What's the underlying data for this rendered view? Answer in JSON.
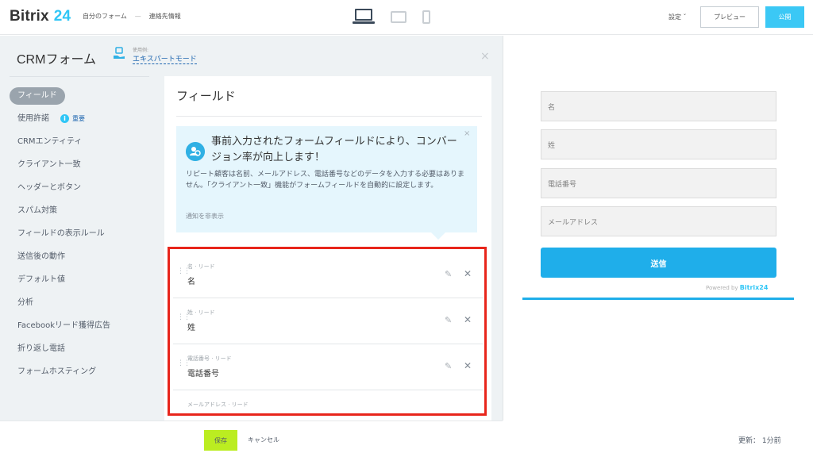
{
  "header": {
    "logo_text": "Bitrix",
    "logo_num": "24",
    "breadcrumb": [
      "自分のフォーム",
      "—",
      "連絡先情報"
    ],
    "devices": [
      "laptop-icon",
      "tablet-icon",
      "phone-icon"
    ],
    "settings_label": "設定 ˇ",
    "preview_label": "プレビュー",
    "publish_label": "公開"
  },
  "panel": {
    "title": "CRMフォーム",
    "mode_small": "使用例:",
    "mode_link": "エキスパートモード",
    "close": "×"
  },
  "sidebar": {
    "items": [
      {
        "label": "フィールド",
        "active": true
      },
      {
        "label": "使用許諾",
        "badge": "重要"
      },
      {
        "label": "CRMエンティティ"
      },
      {
        "label": "クライアント一致"
      },
      {
        "label": "ヘッダーとボタン"
      },
      {
        "label": "スパム対策"
      },
      {
        "label": "フィールドの表示ルール"
      },
      {
        "label": "送信後の動作"
      },
      {
        "label": "デフォルト値"
      },
      {
        "label": "分析"
      },
      {
        "label": "Facebookリード獲得広告"
      },
      {
        "label": "折り返し電話"
      },
      {
        "label": "フォームホスティング"
      }
    ]
  },
  "content": {
    "title": "フィールド",
    "notice": {
      "heading": "事前入力されたフォームフィールドにより、コンバージョン率が向上します！",
      "body": "リピート顧客は名前、メールアドレス、電話番号などのデータを入力する必要はありません。「クライアント一致」機能がフォームフィールドを自動的に設定します。",
      "hide_link": "通知を非表示",
      "close": "×"
    },
    "fields": [
      {
        "sub": "名 · リード",
        "main": "名"
      },
      {
        "sub": "姓 · リード",
        "main": "姓"
      },
      {
        "sub": "電話番号 · リード",
        "main": "電話番号"
      },
      {
        "sub": "メールアドレス · リード",
        "main": ""
      }
    ]
  },
  "footer": {
    "save_label": "保存",
    "cancel_label": "キャンセル",
    "updated": "更新： 1分前"
  },
  "preview": {
    "inputs": [
      "名",
      "姓",
      "電話番号",
      "メールアドレス"
    ],
    "submit_label": "送信",
    "powered_prefix": "Powered by ",
    "powered_brand": "Bitrix24"
  },
  "colors": {
    "accent": "#2fc6f6",
    "save": "#bbed21",
    "highlight_frame": "#e8251b",
    "submit": "#1faeea"
  }
}
